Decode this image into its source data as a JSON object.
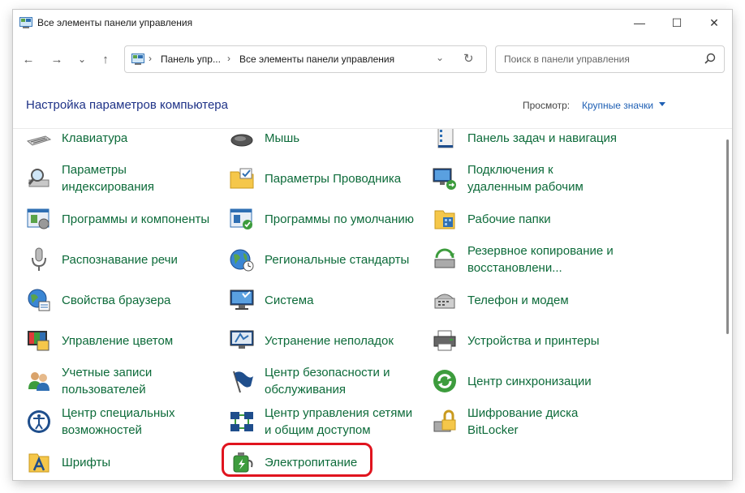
{
  "window": {
    "title": "Все элементы панели управления",
    "controls": {
      "minimize": "—",
      "maximize": "☐",
      "close": "✕"
    }
  },
  "navbar": {
    "back": "←",
    "forward": "→",
    "recent": "⌄",
    "up": "↑",
    "address": {
      "crumbs": [
        "Панель упр...",
        "Все элементы панели управления"
      ],
      "separator": "›",
      "dropdown": "⌄",
      "refresh": "↻"
    },
    "search": {
      "placeholder": "Поиск в панели управления",
      "value": ""
    }
  },
  "header": {
    "title": "Настройка параметров компьютера",
    "view_label": "Просмотр:",
    "view_value": "Крупные значки"
  },
  "items": [
    {
      "label": "Клавиатура",
      "icon": "keyboard-icon"
    },
    {
      "label": "Мышь",
      "icon": "mouse-icon"
    },
    {
      "label": "Панель задач и навигация",
      "icon": "taskbar-icon"
    },
    {
      "label": "Параметры индексирования",
      "icon": "indexing-icon"
    },
    {
      "label": "Параметры Проводника",
      "icon": "folder-options-icon"
    },
    {
      "label": "Подключения к удаленным рабочим",
      "icon": "remote-desktop-icon"
    },
    {
      "label": "Программы и компоненты",
      "icon": "programs-icon"
    },
    {
      "label": "Программы по умолчанию",
      "icon": "default-programs-icon"
    },
    {
      "label": "Рабочие папки",
      "icon": "work-folders-icon"
    },
    {
      "label": "Распознавание речи",
      "icon": "microphone-icon"
    },
    {
      "label": "Региональные стандарты",
      "icon": "region-icon"
    },
    {
      "label": "Резервное копирование и восстановлени...",
      "icon": "backup-icon"
    },
    {
      "label": "Свойства браузера",
      "icon": "internet-options-icon"
    },
    {
      "label": "Система",
      "icon": "system-icon"
    },
    {
      "label": "Телефон и модем",
      "icon": "phone-modem-icon"
    },
    {
      "label": "Управление цветом",
      "icon": "color-management-icon"
    },
    {
      "label": "Устранение неполадок",
      "icon": "troubleshooting-icon"
    },
    {
      "label": "Устройства и принтеры",
      "icon": "printer-icon"
    },
    {
      "label": "Учетные записи пользователей",
      "icon": "user-accounts-icon"
    },
    {
      "label": "Центр безопасности и обслуживания",
      "icon": "security-flag-icon"
    },
    {
      "label": "Центр синхронизации",
      "icon": "sync-center-icon"
    },
    {
      "label": "Центр специальных возможностей",
      "icon": "accessibility-icon"
    },
    {
      "label": "Центр управления сетями и общим доступом",
      "icon": "network-icon"
    },
    {
      "label": "Шифрование диска BitLocker",
      "icon": "bitlocker-icon"
    },
    {
      "label": "Шрифты",
      "icon": "fonts-icon"
    },
    {
      "label": "Электропитание",
      "icon": "power-options-icon"
    }
  ],
  "highlight_color": "#e0141e",
  "link_color": "#0d6b3a",
  "title_color": "#1e3287"
}
